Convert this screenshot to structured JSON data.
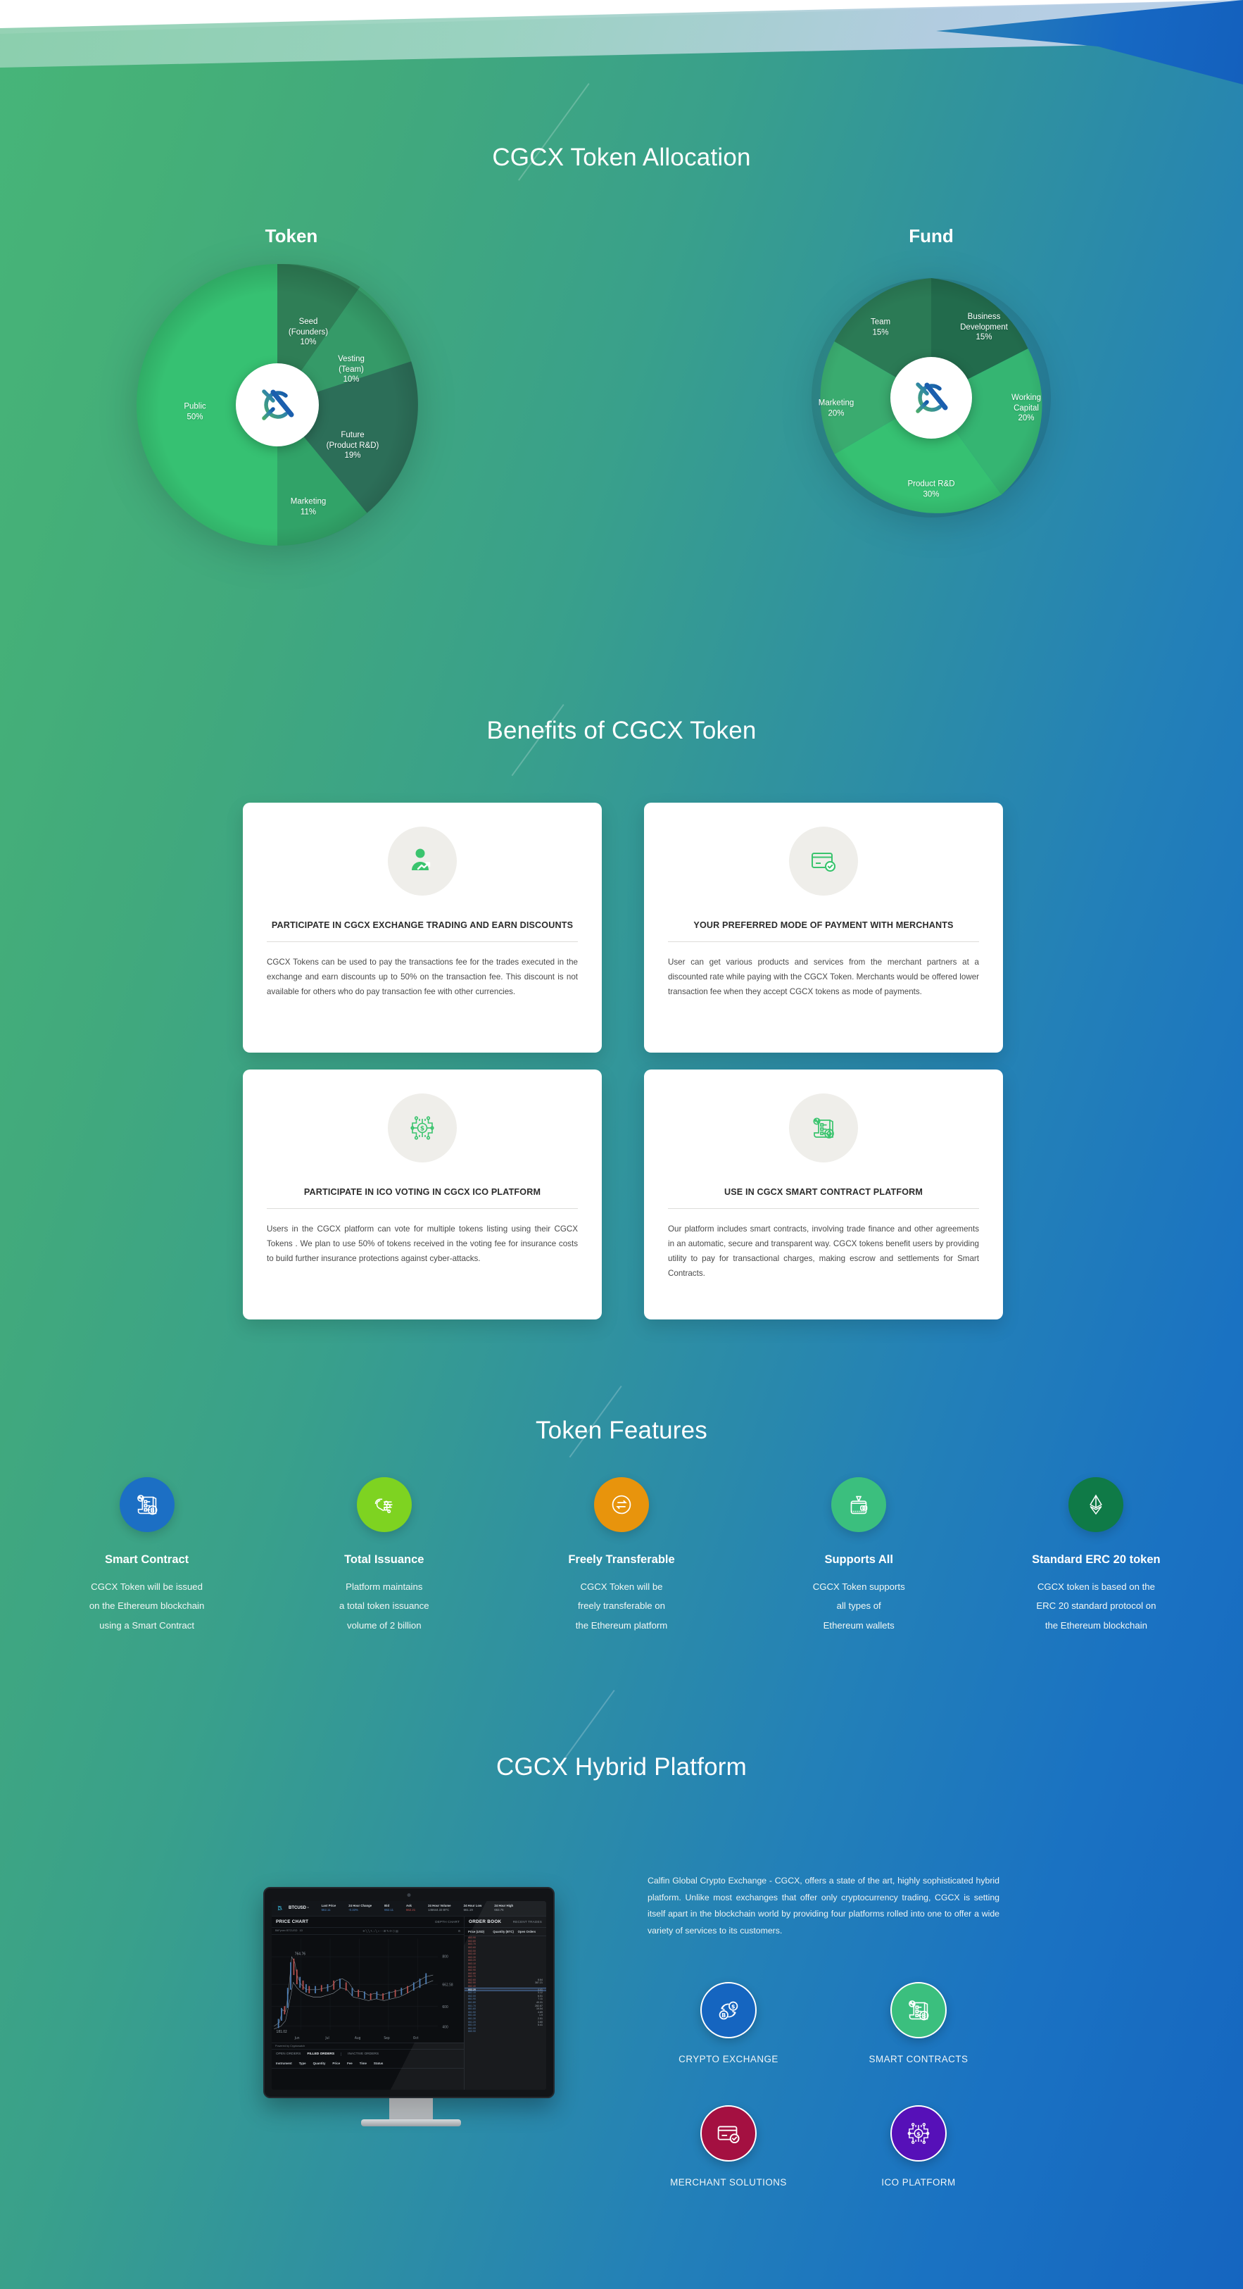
{
  "sections": {
    "allocation_title": "CGCX Token  Allocation",
    "benefits_title": "Benefits of CGCX Token",
    "features_title": "Token Features",
    "hybrid_title": "CGCX Hybrid Platform"
  },
  "chart_data": [
    {
      "type": "pie",
      "title": "Token",
      "categories": [
        "Public",
        "Seed (Founders)",
        "Vesting (Team)",
        "Future (Product R&D)",
        "Marketing"
      ],
      "values": [
        50,
        10,
        10,
        19,
        11
      ],
      "labels": [
        "Public\n50%",
        "Seed\n(Founders)\n10%",
        "Vesting\n(Team)\n10%",
        "Future\n(Product R&D)\n19%",
        "Marketing\n11%"
      ],
      "colors": [
        "#36c172",
        "#2e7d55",
        "#359a68",
        "#2c6e58",
        "#31a368"
      ],
      "legend": "labels-inside",
      "donut_center": "cgcx-logo"
    },
    {
      "type": "pie",
      "title": "Fund",
      "categories": [
        "Business Development",
        "Working Capital",
        "Product R&D",
        "Marketing",
        "Team"
      ],
      "values": [
        15,
        20,
        30,
        20,
        15
      ],
      "labels": [
        "Business\nDevelopment\n15%",
        "Working\nCapital\n20%",
        "Product R&D\n30%",
        "Marketing\n20%",
        "Team\n15%"
      ],
      "colors": [
        "#226b4c",
        "#35b572",
        "#36c172",
        "#3aab6f",
        "#2b7a55"
      ],
      "legend": "labels-inside",
      "donut_center": "cgcx-logo"
    }
  ],
  "benefits": [
    {
      "icon": "user-trading-icon",
      "title": "PARTICIPATE IN CGCX EXCHANGE TRADING AND EARN DISCOUNTS",
      "body": "CGCX Tokens can be used to pay the transactions fee for the trades executed in the exchange and earn discounts up to 50% on the transaction fee. This discount is not available for others who do pay transaction fee with other currencies."
    },
    {
      "icon": "credit-card-check-icon",
      "title": "YOUR PREFERRED MODE OF PAYMENT WITH MERCHANTS",
      "body": "User can get various products and services from the merchant partners at a discounted rate while paying with the CGCX Token. Merchants would be offered lower transaction fee when they accept CGCX tokens as mode of payments."
    },
    {
      "icon": "ico-circuit-dollar-icon",
      "title": "PARTICIPATE IN ICO VOTING IN CGCX ICO PLATFORM",
      "body": "Users in the CGCX platform can vote for multiple tokens listing using their CGCX Tokens . We plan to use 50% of tokens received in the voting fee for insurance costs to build further insurance protections against cyber-attacks."
    },
    {
      "icon": "smart-contract-ethereum-icon",
      "title": "USE IN CGCX SMART CONTRACT PLATFORM",
      "body": "Our platform includes smart contracts, involving trade finance and other agreements in an automatic, secure and transparent way. CGCX tokens benefit users by providing utility to pay for transactional charges, making escrow and settlements for Smart Contracts."
    }
  ],
  "features": [
    {
      "icon": "smart-contract-bitcoin-icon",
      "color": "#1c6fc4",
      "name": "Smart Contract",
      "desc": "CGCX Token will be issued\non the Ethereum blockchain\nusing a Smart Contract"
    },
    {
      "icon": "hand-coins-icon",
      "color": "#7ed321",
      "name": "Total Issuance",
      "desc": "Platform maintains\na total token issuance\nvolume of 2 billion"
    },
    {
      "icon": "transfer-arrows-icon",
      "color": "#e8940c",
      "name": "Freely Transferable",
      "desc": "CGCX Token will be\nfreely transferable on\nthe Ethereum platform"
    },
    {
      "icon": "wallet-icon",
      "color": "#3bbf7e",
      "name": "Supports All",
      "desc": "CGCX Token supports\nall types of\nEthereum wallets"
    },
    {
      "icon": "ethereum-diamond-icon",
      "color": "#0f7a47",
      "name": "Standard ERC 20 token",
      "desc": "CGCX token is based on the\nERC 20 standard protocol on\nthe Ethereum blockchain"
    }
  ],
  "hybrid": {
    "description": "Calfin Global Crypto Exchange - CGCX, offers a state of the art, highly sophisticated hybrid platform. Unlike most exchanges that offer only cryptocurrency trading, CGCX is setting itself apart in the blockchain world by providing four platforms rolled into one to offer a wide variety of services to its customers.",
    "platforms": [
      {
        "icon": "crypto-exchange-icon",
        "color": "#1565c0",
        "name": "CRYPTO EXCHANGE"
      },
      {
        "icon": "smart-contracts-icon",
        "color": "#3bbf7e",
        "name": "SMART CONTRACTS"
      },
      {
        "icon": "merchant-card-icon",
        "color": "#a41041",
        "name": "MERCHANT SOLUTIONS"
      },
      {
        "icon": "ico-platform-icon",
        "color": "#5610b8",
        "name": "ICO PLATFORM"
      }
    ]
  },
  "monitor": {
    "pair": "BTCUSD -",
    "stats": [
      {
        "key": "Last Price",
        "value": "662.11"
      },
      {
        "key": "24 Hour Change",
        "value": "-0.33%"
      },
      {
        "key": "Bid",
        "value": "662.11"
      },
      {
        "key": "Ask",
        "value": "662.21"
      },
      {
        "key": "24 Hour Volume",
        "value": "146644.33 BTC"
      },
      {
        "key": "24 Hour Low",
        "value": "661.19"
      },
      {
        "key": "24 Hour High",
        "value": "663.76"
      }
    ],
    "price_chart_title": "PRICE CHART",
    "depth_chart_link": "DEPTH CHART",
    "order_book_title": "ORDER BOOK",
    "recent_trades_link": "RECENT TRADES",
    "toolbar_pair": "BitFynex BTCUSD",
    "toolbar_interval": "1D",
    "chart_high_label": "764.76",
    "chart_low_label": "181.02",
    "y_ticks": [
      "800",
      "662.58",
      "600",
      "400"
    ],
    "x_ticks": [
      "Jun",
      "Jul",
      "Aug",
      "Sep",
      "Oct"
    ],
    "powered_by": "Powered by Cryptowatch",
    "order_tabs": [
      "OPEN ORDERS",
      "FILLED ORDERS",
      "INACTIVE ORDERS"
    ],
    "order_columns": [
      "Instrument",
      "Type",
      "Quantity",
      "Price",
      "Fee",
      "Time",
      "Status"
    ],
    "ob_columns": [
      "Price (USD)",
      "Quantity (BTC)",
      "Open Orders"
    ],
    "ob_mark_price": "662.20"
  }
}
